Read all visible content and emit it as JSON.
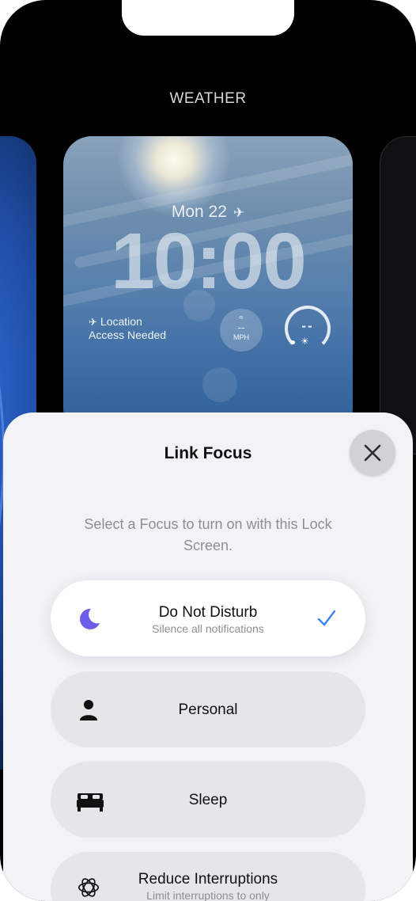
{
  "gallery": {
    "label": "WEATHER"
  },
  "lock_screen": {
    "date": "Mon 22",
    "time": "10:00",
    "location_line1": "Location",
    "location_line2": "Access Needed",
    "wind": {
      "value": "--",
      "unit": "MPH"
    },
    "gauge": {
      "value": "--"
    }
  },
  "sheet": {
    "title": "Link Focus",
    "subtitle": "Select a Focus to turn on with this Lock Screen.",
    "options": [
      {
        "label": "Do Not Disturb",
        "description": "Silence all notifications",
        "icon": "moon-icon",
        "selected": true
      },
      {
        "label": "Personal",
        "icon": "person-icon"
      },
      {
        "label": "Sleep",
        "icon": "bed-icon"
      },
      {
        "label": "Reduce Interruptions",
        "description": "Limit interruptions to only",
        "icon": "flower-icon"
      }
    ]
  },
  "colors": {
    "accent": "#3b82f6",
    "moon": "#6c5ce7"
  }
}
